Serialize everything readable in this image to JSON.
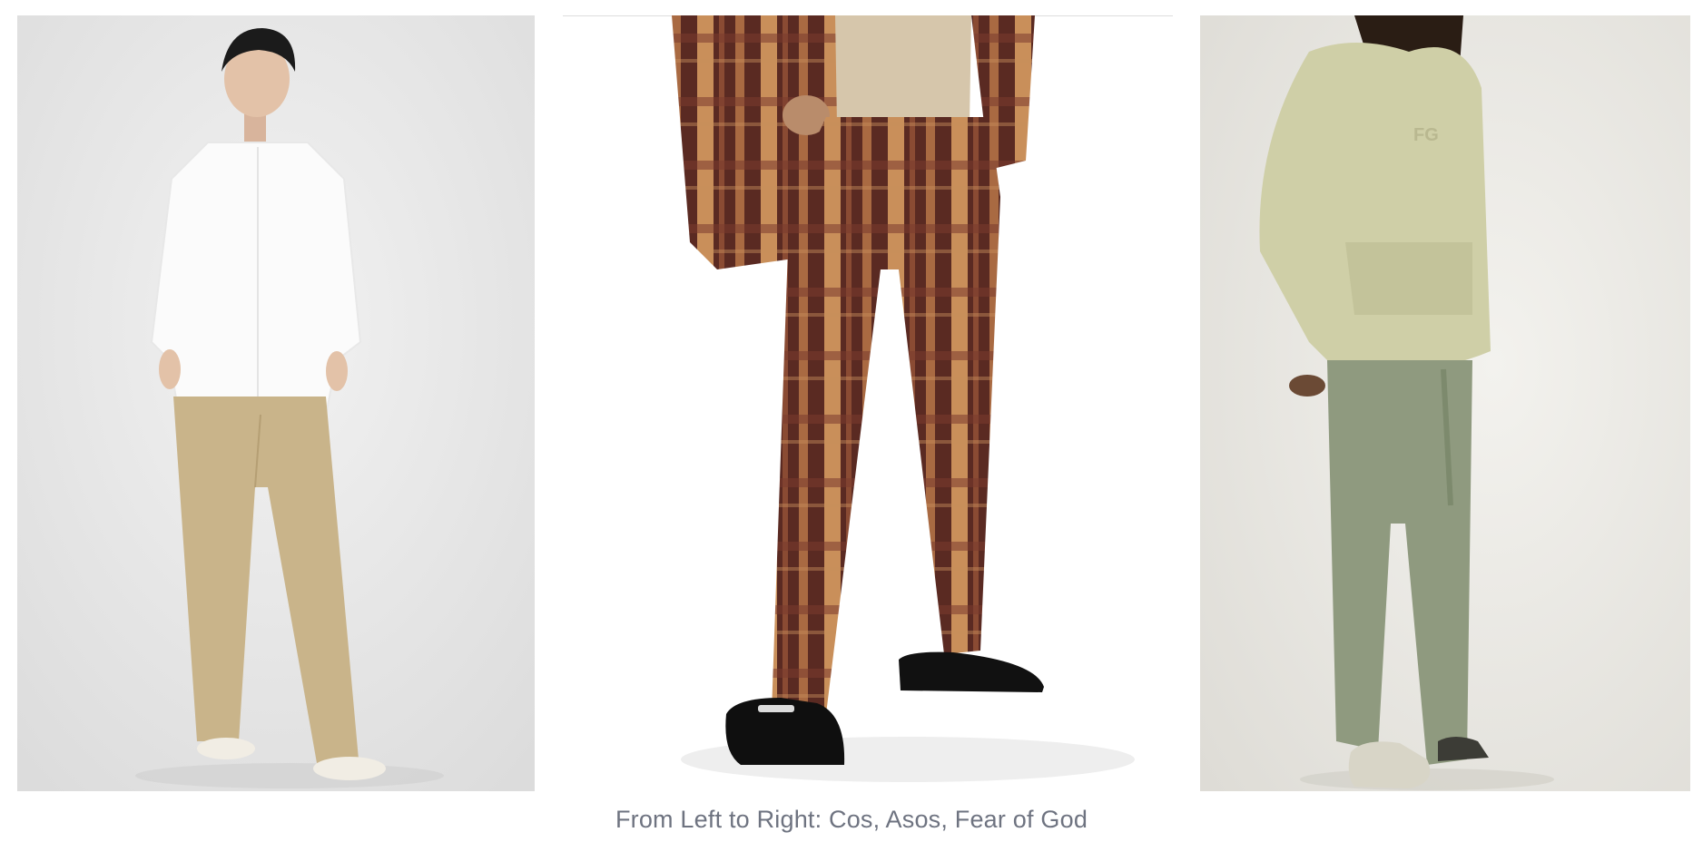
{
  "figure": {
    "images": [
      {
        "description": "Model wearing a white band-collar shirt, wide-leg beige trousers and white sneakers",
        "icon": "photo-icon"
      },
      {
        "description": "Model wearing brown plaid wide-leg suit trousers and matching blazer with black chunky loafers",
        "icon": "photo-icon"
      },
      {
        "description": "Model wearing a sage hoodie with FG logo, olive wide cargo trousers and dark slip-on shoes",
        "icon": "photo-icon"
      }
    ],
    "caption": "From Left to Right: Cos, Asos, Fear of God",
    "logo_text": "FG"
  },
  "colors": {
    "caption": "#6e7380",
    "bg1": "#e6e6e6",
    "bg3": "#ebeae6",
    "shirt": "#fbfbfb",
    "trouser1": "#c9b48a",
    "plaid_dark": "#5a2a22",
    "plaid_light": "#c98f5a",
    "hoodie": "#cfcfa7",
    "cargo": "#8f9a7f"
  }
}
